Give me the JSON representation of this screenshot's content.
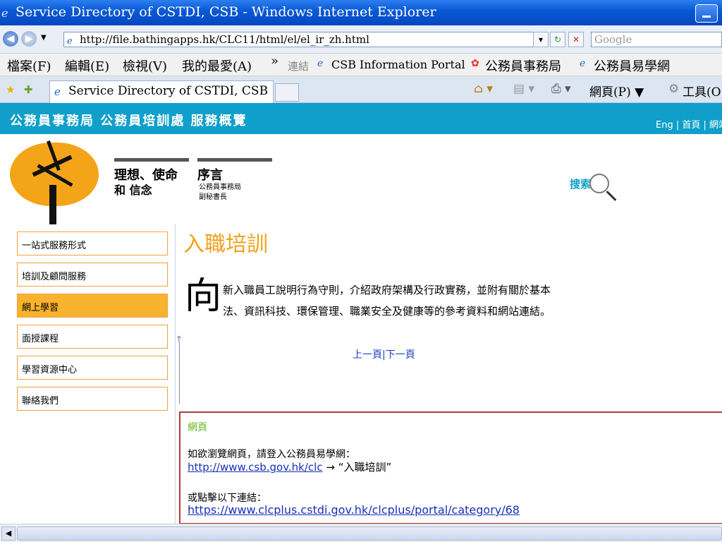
{
  "window": {
    "title": "Service Directory of CSTDI, CSB - Windows Internet Explorer"
  },
  "address_bar": {
    "url": "http://file.bathingapps.hk/CLC11/html/el/el_ir_zh.html",
    "search_placeholder": "Google"
  },
  "menu": {
    "items": [
      "檔案(F)",
      "編輯(E)",
      "檢視(V)",
      "我的最愛(A)"
    ],
    "chevron": "»",
    "links_label": "連結",
    "favorites": [
      "CSB Information Portal",
      "公務員事務局",
      "公務員易學網"
    ]
  },
  "tabs": {
    "active": "Service Directory of CSTDI, CSB",
    "toolbar": [
      "網頁(P) ▼",
      "工具(O"
    ]
  },
  "banner": {
    "title": "公務員事務局 公務員培訓處 服務概覽",
    "right_links": "Eng | 首頁 | 網站"
  },
  "top_nav": {
    "vision_line1": "理想、使命",
    "vision_line2": "和 信念",
    "preface_title": "序言",
    "preface_sub1": "公務員事務局",
    "preface_sub2": "副秘書長",
    "search_label": "搜索"
  },
  "side_nav": [
    {
      "label": "一站式服務形式",
      "active": false
    },
    {
      "label": "培訓及顧問服務",
      "active": false
    },
    {
      "label": "網上學習",
      "active": true
    },
    {
      "label": "面授課程",
      "active": false
    },
    {
      "label": "學習資源中心",
      "active": false
    },
    {
      "label": "聯絡我們",
      "active": false
    }
  ],
  "content": {
    "heading": "入職培訓",
    "drop_cap": "向",
    "intro_line1": "新入職員工說明行為守則，介紹政府架構及行政實務，並附有關於基本",
    "intro_line2": "法、資訊科技、環保管理、職業安全及健康等的參考資料和網站連結。",
    "prev_page": "上一頁",
    "separator": "|",
    "next_page": "下一頁"
  },
  "note_box": {
    "title": "網頁",
    "line1": "如欲瀏覽網頁，請登入公務員易學網：",
    "link1": "http://www.csb.gov.hk/clc",
    "link1_suffix": " → “入職培訓”",
    "line2": "或點擊以下連結：",
    "link2": "https://www.clcplus.cstdi.gov.hk/clcplus/portal/category/68"
  },
  "colors": {
    "banner": "#0f9fca",
    "heading": "#f0a01c",
    "active_nav": "#f7b22e",
    "note_border": "#b13b3b",
    "note_title": "#63b81a"
  }
}
